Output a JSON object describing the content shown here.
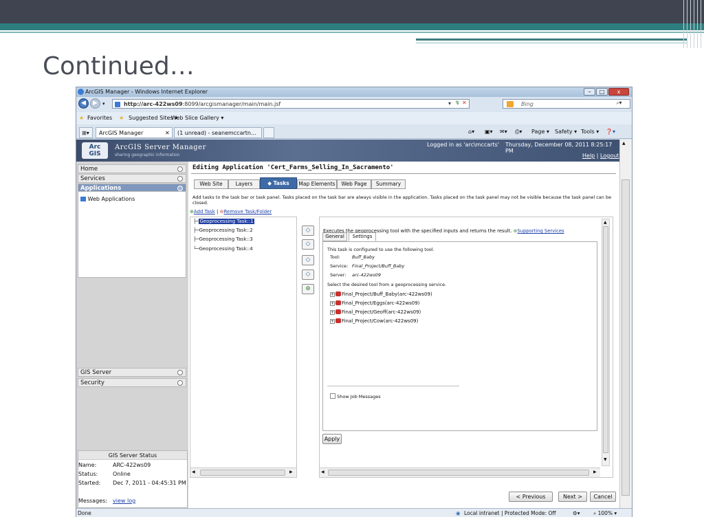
{
  "slide": {
    "title": "Continued…"
  },
  "browser": {
    "window_title": "ArcGIS Manager - Windows Internet Explorer",
    "url_host": "http://arc-422ws09",
    "url_rest": ":8099/arcgismanager/main/main.jsf",
    "search_placeholder": "Bing",
    "favorites_label": "Favorites",
    "fav_items": [
      "Suggested Sites ▾",
      "Web Slice Gallery ▾"
    ],
    "tabs": [
      "ArcGIS Manager",
      "(1 unread) - seanemccartn..."
    ],
    "toolbar_items": [
      "Page ▾",
      "Safety ▾",
      "Tools ▾"
    ],
    "status_left": "Done",
    "status_zone": "Local intranet | Protected Mode: Off",
    "zoom": "100%"
  },
  "app": {
    "brand_top": "Arc",
    "brand_bottom": "GIS",
    "product": "ArcGIS Server Manager",
    "tagline": "sharing geographic information",
    "logged_in": "Logged in as 'arc\\mccarts'",
    "datetime": "Thursday, December 08, 2011 8:25:17 PM",
    "help": "Help",
    "logout": "Logout"
  },
  "sidebar": {
    "items": [
      "Home",
      "Services",
      "Applications"
    ],
    "sub_item": "Web Applications",
    "lower_items": [
      "GIS Server",
      "Security"
    ],
    "status_title": "GIS Server Status",
    "status_rows": [
      {
        "label": "Name:",
        "value": "ARC-422ws09"
      },
      {
        "label": "Status:",
        "value": "Online"
      },
      {
        "label": "Started:",
        "value": "Dec 7, 2011 - 04:45:31 PM"
      },
      {
        "label": "Messages:",
        "value": "view log"
      }
    ]
  },
  "main": {
    "heading": "Editing Application 'Cert_Farms_Selling_In_Sacramento'",
    "tabs": [
      "Web Site",
      "Layers",
      "Tasks",
      "Map Elements",
      "Web Page",
      "Summary"
    ],
    "active_tab": "Tasks",
    "instructions": "Add tasks to the task bar or task panel. Tasks placed on the task bar are always visible in the application. Tasks placed on the task panel may not be visible because the task panel can be closed.",
    "add_task": "Add Task",
    "separator": "|",
    "remove_task": "Remove Task/Folder",
    "tasks": [
      "Geoprocessing Task::1",
      "Geoprocessing Task::2",
      "Geoprocessing Task::3",
      "Geoprocessing Task::4"
    ],
    "task_desc": "Executes the geoprocessing tool with the specified inputs and returns the result.",
    "supporting_services": "Supporting Services",
    "subtabs": [
      "General",
      "Settings"
    ],
    "config_intro": "This task is configured to use the following tool.",
    "config": [
      {
        "label": "Tool:",
        "value": "Buff_Baby"
      },
      {
        "label": "Service:",
        "value": "Final_Project/Buff_Baby"
      },
      {
        "label": "Server:",
        "value": "arc-422ws09"
      }
    ],
    "select_prompt": "Select the desired tool from a geoprocessing service.",
    "services": [
      "Final_Project/Buff_Baby(arc-422ws09)",
      "Final_Project/Eggs(arc-422ws09)",
      "Final_Project/Geoff(arc-422ws09)",
      "Final_Project/Cow(arc-422ws09)"
    ],
    "show_job_messages": "Show Job Messages",
    "apply": "Apply",
    "prev": "< Previous",
    "next": "Next >",
    "cancel": "Cancel"
  }
}
